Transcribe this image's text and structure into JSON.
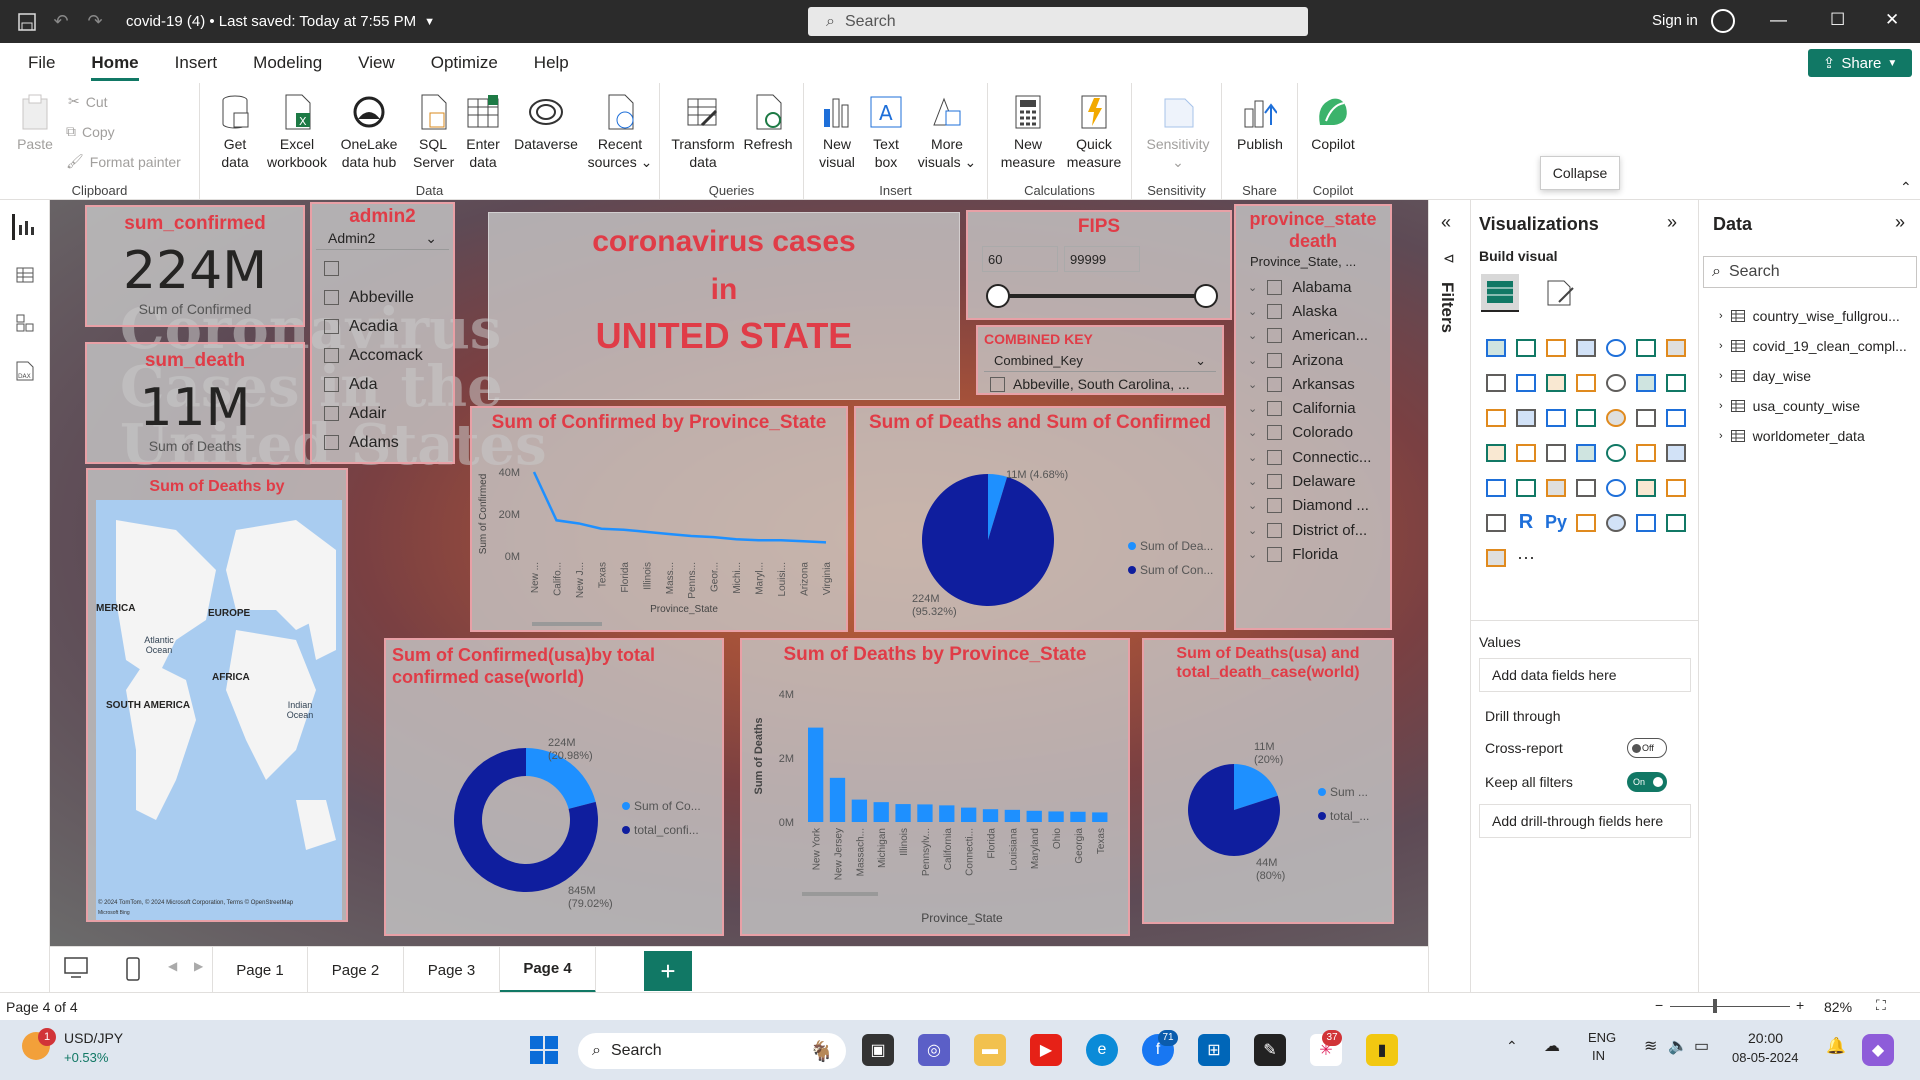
{
  "titlebar": {
    "doc_title": "covid-19 (4)  •  Last saved: Today at 7:55 PM",
    "search": "Search",
    "signin": "Sign in"
  },
  "menu": [
    "File",
    "Home",
    "Insert",
    "Modeling",
    "View",
    "Optimize",
    "Help"
  ],
  "share_label": "Share",
  "ribbon": {
    "clipboard": {
      "paste": "Paste",
      "cut": "Cut",
      "copy": "Copy",
      "format_painter": "Format painter",
      "label": "Clipboard"
    },
    "data": {
      "get_data": "Get data",
      "excel": "Excel workbook",
      "onelake": "OneLake data hub",
      "sql": "SQL Server",
      "enter": "Enter data",
      "dataverse": "Dataverse",
      "recent": "Recent sources",
      "label": "Data"
    },
    "queries": {
      "transform": "Transform data",
      "refresh": "Refresh",
      "label": "Queries"
    },
    "insert": {
      "new_visual": "New visual",
      "text_box": "Text box",
      "more_visuals": "More visuals",
      "label": "Insert"
    },
    "calculations": {
      "new_measure": "New measure",
      "quick_measure": "Quick measure",
      "label": "Calculations"
    },
    "sensitivity": {
      "btn": "Sensitivity",
      "label": "Sensitivity"
    },
    "share": {
      "publish": "Publish",
      "label": "Share"
    },
    "copilot": {
      "btn": "Copilot",
      "label": "Copilot"
    }
  },
  "tooltip": "Collapse",
  "colors": {
    "accent": "#117865",
    "title_red": "#e03c47",
    "series_light": "#1e90ff",
    "series_dark": "#0f1e9e"
  },
  "report": {
    "background_text": [
      "Coronavirus",
      "Cases in the",
      "United States"
    ],
    "card_confirmed": {
      "title": "sum_confirmed",
      "value": "224M",
      "label": "Sum of Confirmed"
    },
    "card_death": {
      "title": "sum_death",
      "value": "11M",
      "label": "Sum of Deaths"
    },
    "admin2_slicer": {
      "title": "admin2",
      "dropdown": "Admin2",
      "items": [
        "",
        "Abbeville",
        "Acadia",
        "Accomack",
        "Ada",
        "Adair",
        "Adams"
      ]
    },
    "headline": {
      "line1": "coronavirus cases",
      "line2": "in",
      "line3": "UNITED STATE"
    },
    "fips": {
      "title": "FIPS",
      "min": "60",
      "max": "99999"
    },
    "combined_key": {
      "title": "COMBINED KEY",
      "dropdown": "Combined_Key",
      "item": "Abbeville, South Carolina, ..."
    },
    "province_slicer": {
      "title": "province_state death",
      "header": "Province_State, ...",
      "items": [
        "Alabama",
        "Alaska",
        "American...",
        "Arizona",
        "Arkansas",
        "California",
        "Colorado",
        "Connectic...",
        "Delaware",
        "Diamond ...",
        "District of...",
        "Florida"
      ]
    },
    "map": {
      "title": "Sum of Deaths by Country_Region",
      "labels": {
        "america": "MERICA",
        "europe": "EUROPE",
        "atlantic": "Atlantic Ocean",
        "africa": "AFRICA",
        "south_america": "SOUTH AMERICA",
        "indian": "Indian Ocean"
      },
      "copyright": "© 2024 TomTom, © 2024 Microsoft Corporation, Terms © OpenStreetMap",
      "bing": "Microsoft Bing"
    }
  },
  "chart_data": [
    {
      "type": "line",
      "title": "Sum of Confirmed by Province_State",
      "xlabel": "Province_State",
      "ylabel": "Sum of Confirmed",
      "yticks": [
        "40M",
        "20M",
        "0M"
      ],
      "ylim": [
        0,
        40
      ],
      "categories": [
        "New ...",
        "Califo...",
        "New J...",
        "Texas",
        "Florida",
        "Illinois",
        "Mass...",
        "Penns...",
        "Geor...",
        "Michi...",
        "Maryl...",
        "Louisi...",
        "Arizona",
        "Virginia"
      ],
      "values": [
        40,
        17,
        15.5,
        13,
        12.5,
        11.5,
        10.5,
        9.5,
        9,
        8,
        7.5,
        7.5,
        7,
        6.5
      ]
    },
    {
      "type": "pie",
      "title": "Sum of Deaths and Sum of Confirmed",
      "series": [
        {
          "name": "Sum of Dea...",
          "value": 11,
          "label": "11M (4.68%)"
        },
        {
          "name": "Sum of Con...",
          "value": 224,
          "label": "224M (95.32%)"
        }
      ]
    },
    {
      "type": "pie",
      "title": "Sum of Confirmed(usa)by total confirmed case(world)",
      "donut": true,
      "series": [
        {
          "name": "Sum of Co...",
          "value": 224,
          "label": "224M (20.98%)"
        },
        {
          "name": "total_confi...",
          "value": 845,
          "label": "845M (79.02%)"
        }
      ]
    },
    {
      "type": "bar",
      "title": "Sum of Deaths by Province_State",
      "xlabel": "Province_State",
      "ylabel": "Sum of Deaths",
      "yticks": [
        "4M",
        "2M",
        "0M"
      ],
      "ylim": [
        0,
        4
      ],
      "categories": [
        "New York",
        "New Jersey",
        "Massach...",
        "Michigan",
        "Illinois",
        "Pennsylv...",
        "California",
        "Connecti...",
        "Florida",
        "Louisiana",
        "Maryland",
        "Ohio",
        "Georgia",
        "Texas"
      ],
      "values": [
        2.95,
        1.38,
        0.7,
        0.62,
        0.56,
        0.55,
        0.52,
        0.45,
        0.4,
        0.38,
        0.35,
        0.33,
        0.32,
        0.3
      ]
    },
    {
      "type": "pie",
      "title": "Sum of Deaths(usa) and total_death_case(world)",
      "series": [
        {
          "name": "Sum ...",
          "value": 11,
          "label": "11M (20%)"
        },
        {
          "name": "total_...",
          "value": 44,
          "label": "44M (80%)"
        }
      ]
    }
  ],
  "filters_label": "Filters",
  "visualizations": {
    "title": "Visualizations",
    "build": "Build visual",
    "values": "Values",
    "add_fields": "Add data fields here",
    "drill": "Drill through",
    "cross_report": "Cross-report",
    "cross_state": "Off",
    "keep_filters": "Keep all filters",
    "keep_state": "On",
    "add_drill": "Add drill-through fields here"
  },
  "data_pane": {
    "title": "Data",
    "search": "Search",
    "tables": [
      "country_wise_fullgrou...",
      "covid_19_clean_compl...",
      "day_wise",
      "usa_county_wise",
      "worldometer_data"
    ]
  },
  "pages": [
    "Page 1",
    "Page 2",
    "Page 3",
    "Page 4"
  ],
  "status": {
    "page": "Page 4 of 4",
    "zoom": "82%"
  },
  "taskbar": {
    "ticker": "USD/JPY",
    "change": "+0.53%",
    "search": "Search",
    "lang1": "ENG",
    "lang2": "IN",
    "time": "20:00",
    "date": "08-05-2024",
    "badge_ticker": "1",
    "badge_a": "71",
    "badge_b": "37"
  }
}
